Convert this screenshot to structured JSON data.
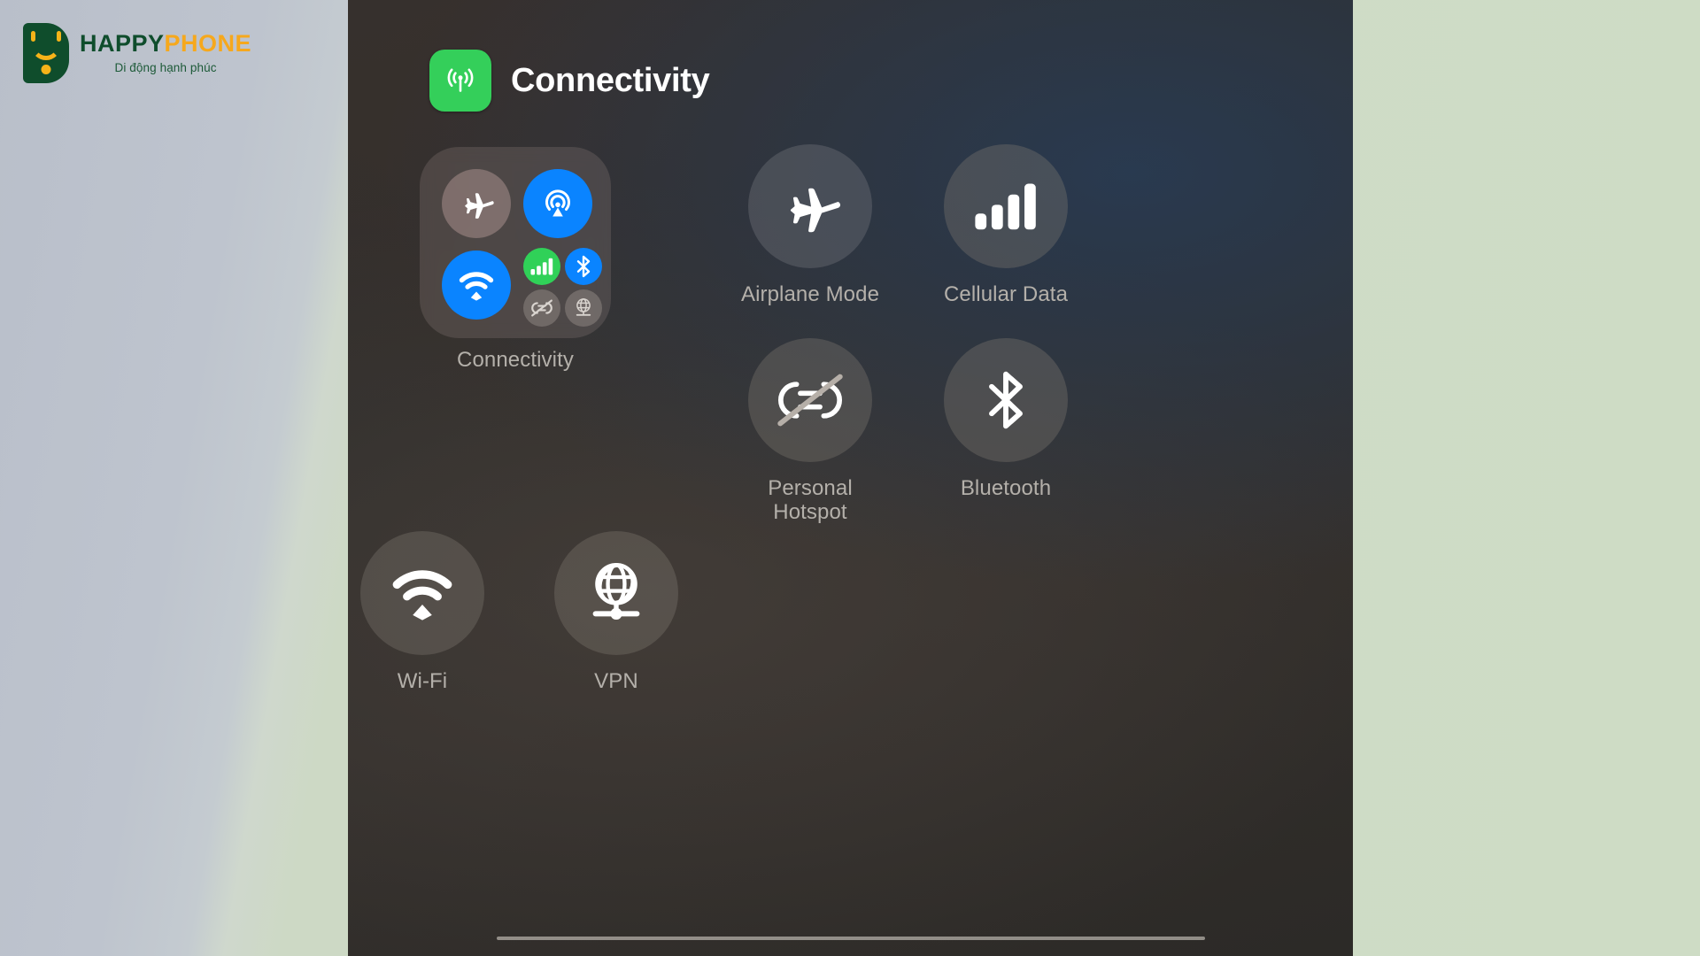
{
  "brand": {
    "name_part1": "HAPPY",
    "name_part2": "PHONE",
    "tagline": "Di động hạnh phúc",
    "mark_icon": "shopping-bag-icon",
    "color_green": "#0f4d2c",
    "color_orange": "#f6a81c"
  },
  "panel": {
    "title": "Connectivity",
    "app_icon": "broadcast-antenna-icon",
    "app_icon_color": "#34cf5a",
    "background_color": "#302e2c",
    "home_indicator": "home-indicator-bar"
  },
  "connectivity_module": {
    "label": "Connectivity",
    "controls": [
      {
        "name": "airplane-mode",
        "icon": "airplane-icon",
        "state": "off",
        "color": "#a99490",
        "size": "large"
      },
      {
        "name": "airdrop",
        "icon": "airdrop-icon",
        "state": "on",
        "color": "#0a84ff",
        "size": "large"
      },
      {
        "name": "wifi",
        "icon": "wifi-icon",
        "state": "on",
        "color": "#0a84ff",
        "size": "large"
      },
      {
        "name": "cellular-data",
        "icon": "cellular-bars-icon",
        "state": "on",
        "color": "#30d158",
        "size": "small"
      },
      {
        "name": "bluetooth",
        "icon": "bluetooth-icon",
        "state": "on",
        "color": "#0a84ff",
        "size": "small"
      },
      {
        "name": "personal-hotspot",
        "icon": "hotspot-off-icon",
        "state": "off",
        "color": "#8b837c",
        "size": "small"
      },
      {
        "name": "vpn",
        "icon": "vpn-globe-icon",
        "state": "off",
        "color": "#8b837c",
        "size": "small"
      }
    ]
  },
  "tiles": [
    {
      "name": "airplane-mode",
      "label": "Airplane Mode",
      "icon": "airplane-icon",
      "state": "off"
    },
    {
      "name": "cellular-data",
      "label": "Cellular Data",
      "icon": "cellular-bars-icon",
      "state": "off"
    },
    {
      "name": "personal-hotspot",
      "label": "Personal\nHotspot",
      "icon": "hotspot-off-icon",
      "state": "off"
    },
    {
      "name": "bluetooth",
      "label": "Bluetooth",
      "icon": "bluetooth-icon",
      "state": "off"
    },
    {
      "name": "wifi",
      "label": "Wi-Fi",
      "icon": "wifi-icon",
      "state": "off"
    },
    {
      "name": "vpn",
      "label": "VPN",
      "icon": "vpn-globe-icon",
      "state": "off"
    }
  ]
}
